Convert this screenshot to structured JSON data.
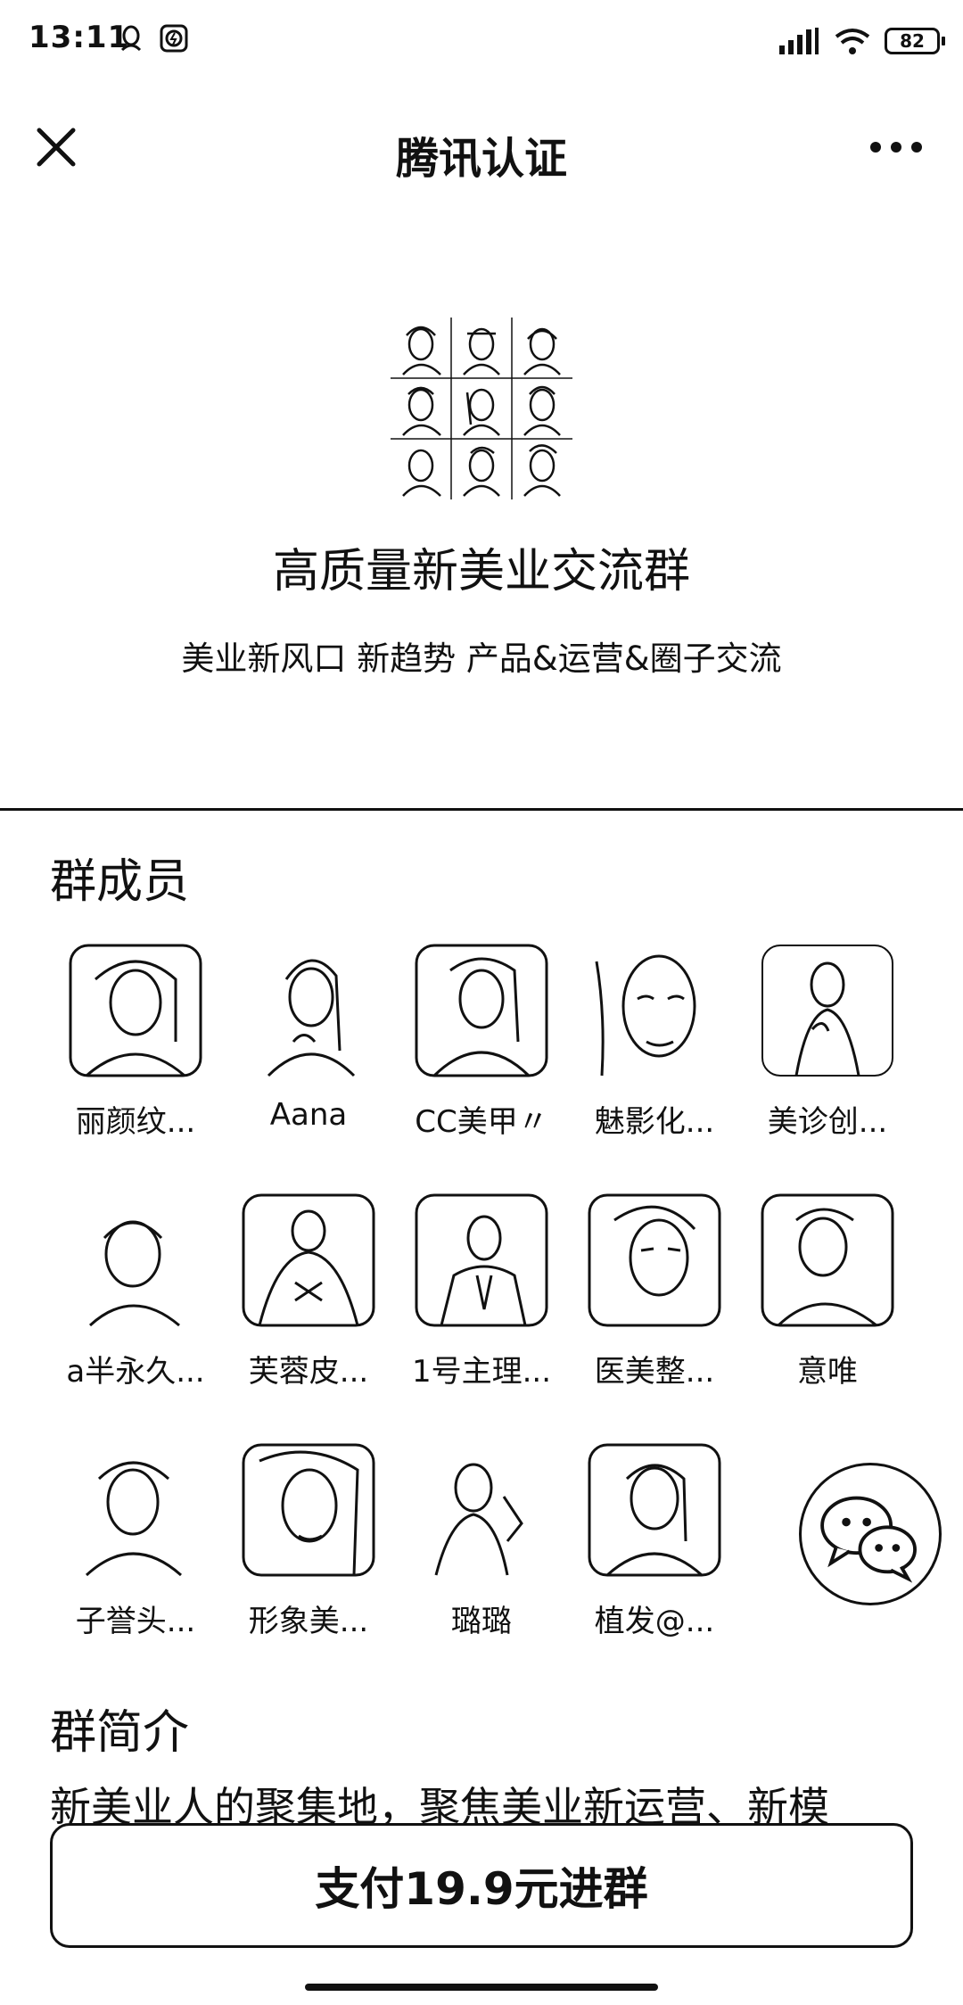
{
  "status_bar": {
    "time": "13:11",
    "battery": "82",
    "icons": [
      "notification-icon",
      "shield-app-icon",
      "signal-icon",
      "wifi-icon",
      "battery-icon"
    ]
  },
  "header": {
    "title": "腾讯认证",
    "close_icon": "close-icon",
    "more_icon": "more-icon"
  },
  "group": {
    "name": "高质量新美业交流群",
    "tagline": "美业新风口 新趋势 产品&运营&圈子交流"
  },
  "members": {
    "title": "群成员",
    "items": [
      {
        "name": "丽颜纹..."
      },
      {
        "name": "Aana"
      },
      {
        "name": "CC美甲〃"
      },
      {
        "name": "魅影化..."
      },
      {
        "name": "美诊创..."
      },
      {
        "name": "a半永久..."
      },
      {
        "name": "芙蓉皮..."
      },
      {
        "name": "1号主理..."
      },
      {
        "name": "医美整..."
      },
      {
        "name": "意唯"
      },
      {
        "name": "子誉头..."
      },
      {
        "name": "形象美..."
      },
      {
        "name": "璐璐"
      },
      {
        "name": "植发@..."
      }
    ]
  },
  "intro": {
    "title": "群简介",
    "text": "新美业人的聚集地，聚焦美业新运营、新模"
  },
  "pay_button": {
    "label": "支付19.9元进群"
  },
  "colors": {
    "foreground": "#111111",
    "background": "#ffffff"
  }
}
